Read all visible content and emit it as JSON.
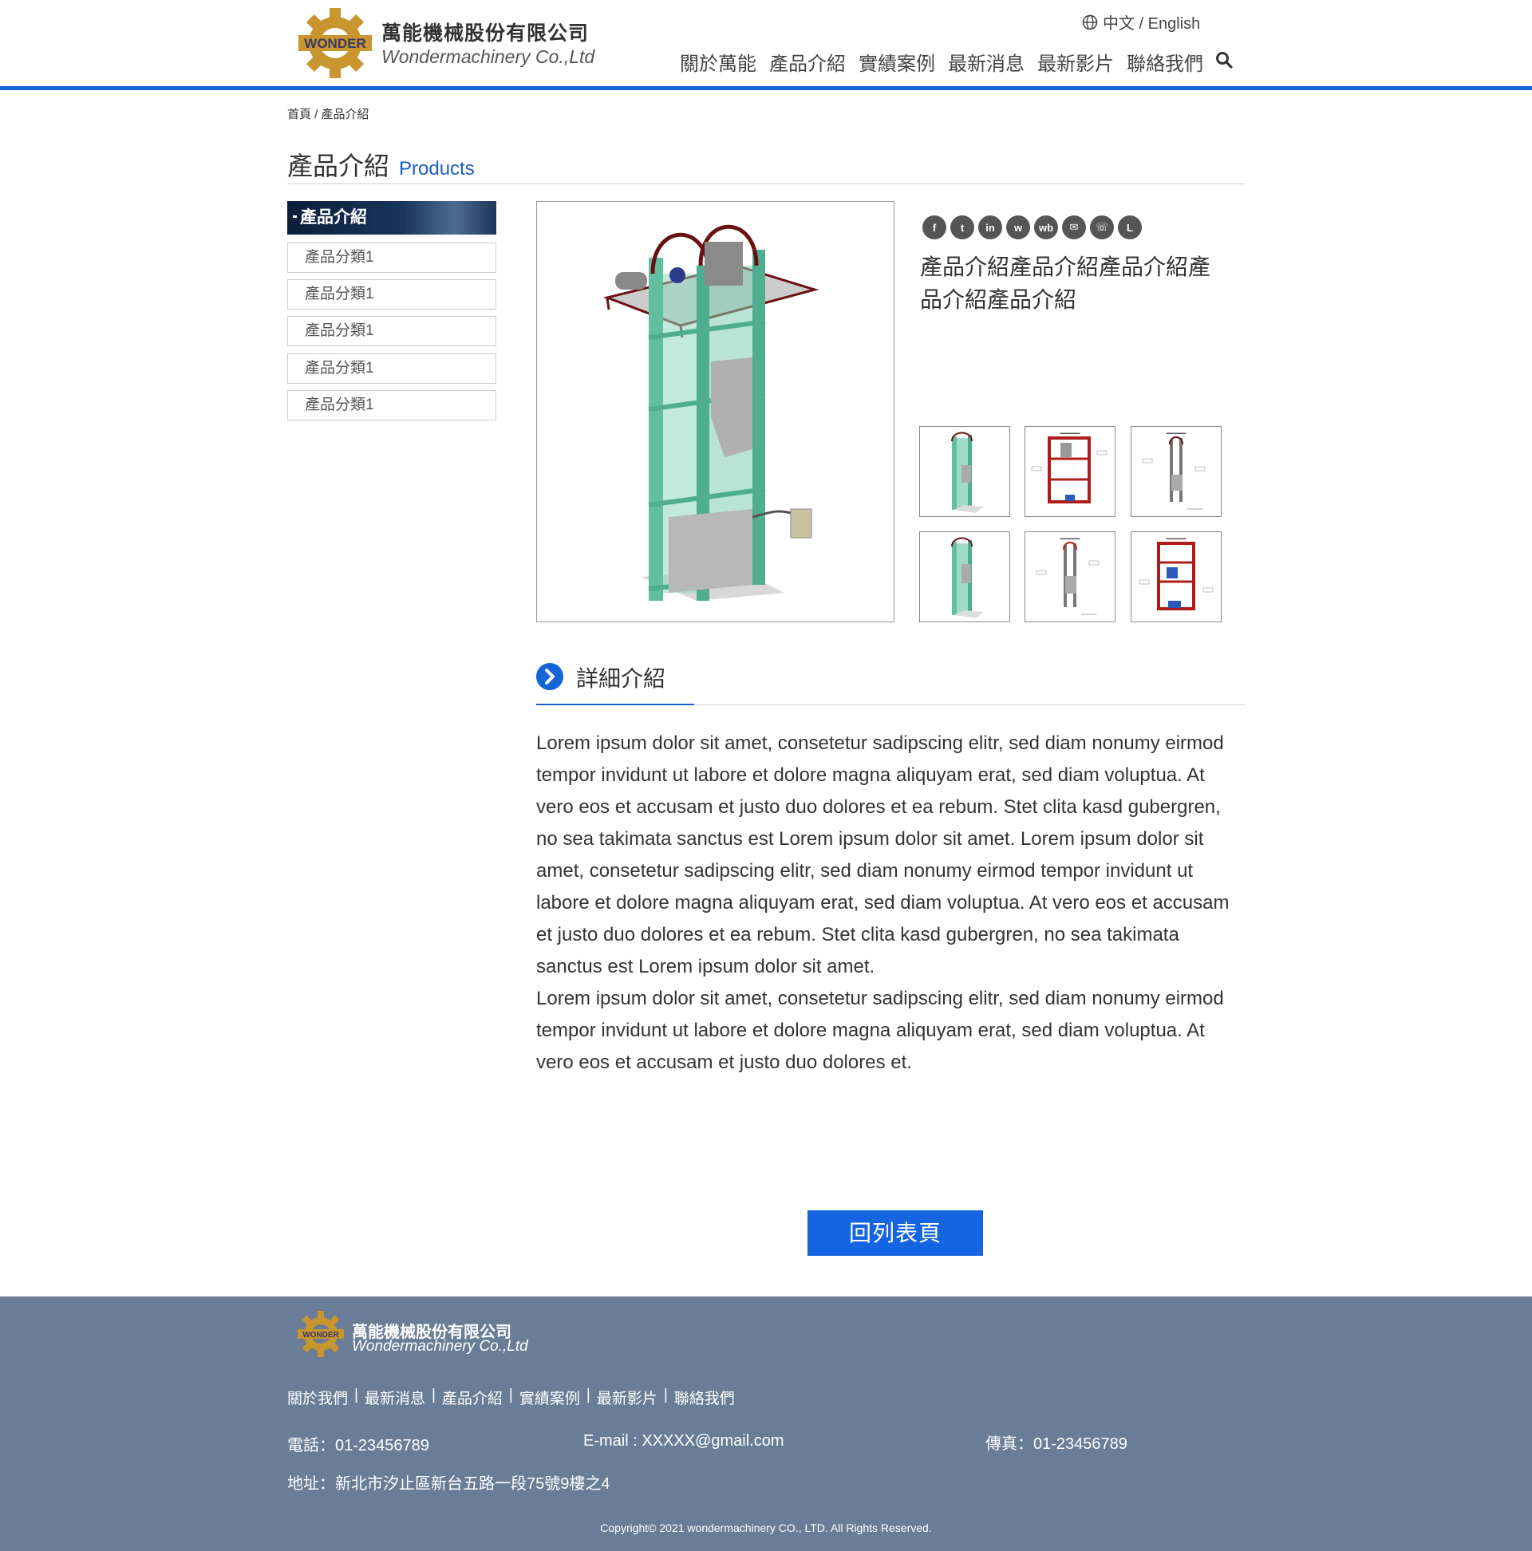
{
  "header": {
    "brand_cn": "萬能機械股份有限公司",
    "brand_en": "Wondermachinery Co.,Ltd",
    "logo_text": "WONDER",
    "lang_switch": "中文 / English",
    "nav": [
      "關於萬能",
      "產品介紹",
      "實績案例",
      "最新消息",
      "最新影片",
      "聯絡我們"
    ]
  },
  "breadcrumb": "首頁 / 產品介紹",
  "page_title": {
    "cn": "產品介紹",
    "en": "Products"
  },
  "sidebar": {
    "heading": "產品介紹",
    "items": [
      "產品分類1",
      "產品分類1",
      "產品分類1",
      "產品分類1",
      "產品分類1"
    ]
  },
  "share_icons": [
    "facebook-icon",
    "twitter-icon",
    "linkedin-icon",
    "wechat-icon",
    "weibo-icon",
    "email-icon",
    "whatsapp-icon",
    "line-icon"
  ],
  "product": {
    "name": "產品介紹產品介紹產品介紹產品介紹產品介紹",
    "thumbnails": [
      "green-elevator-view",
      "red-frame-drawing",
      "gray-drawing",
      "green-elevator-view",
      "gray-drawing",
      "red-frame-drawing"
    ]
  },
  "detail": {
    "title": "詳細介紹",
    "paragraphs": [
      "Lorem ipsum dolor sit amet, consetetur sadipscing elitr, sed diam nonumy eirmod tempor invidunt ut labore et dolore magna aliquyam erat, sed diam voluptua. At vero eos et accusam et justo duo dolores et ea rebum. Stet clita kasd gubergren, no sea takimata sanctus est Lorem ipsum dolor sit amet. Lorem ipsum dolor sit amet, consetetur sadipscing elitr, sed diam nonumy eirmod tempor invidunt ut labore et dolore magna aliquyam erat, sed diam voluptua. At vero eos et accusam et justo duo dolores et ea rebum. Stet clita kasd gubergren, no sea takimata sanctus est Lorem ipsum dolor sit amet.",
      "Lorem ipsum dolor sit amet, consetetur sadipscing elitr, sed diam nonumy eirmod tempor invidunt ut labore et dolore magna aliquyam erat, sed diam voluptua. At vero eos et accusam et justo duo dolores et."
    ]
  },
  "back_button": "回列表頁",
  "footer": {
    "brand_cn": "萬能機械股份有限公司",
    "brand_en": "Wondermachinery Co.,Ltd",
    "links": [
      "關於我們",
      "最新消息",
      "產品介紹",
      "實績案例",
      "最新影片",
      "聯絡我們"
    ],
    "tel": "電話：01-23456789",
    "email": "E-mail :  XXXXX@gmail.com",
    "fax": "傳真：01-23456789",
    "address": "地址：新北市汐止區新台五路一段75號9樓之4",
    "copyright": "Copyright© 2021 wondermachinery  CO., LTD. All Rights Reserved."
  },
  "colors": {
    "accent": "#1565d8",
    "footer_bg": "#6a7d97",
    "logo_gold": "#c8952e",
    "machine_green": "#5fbf9f",
    "frame_red": "#b01c1c"
  }
}
